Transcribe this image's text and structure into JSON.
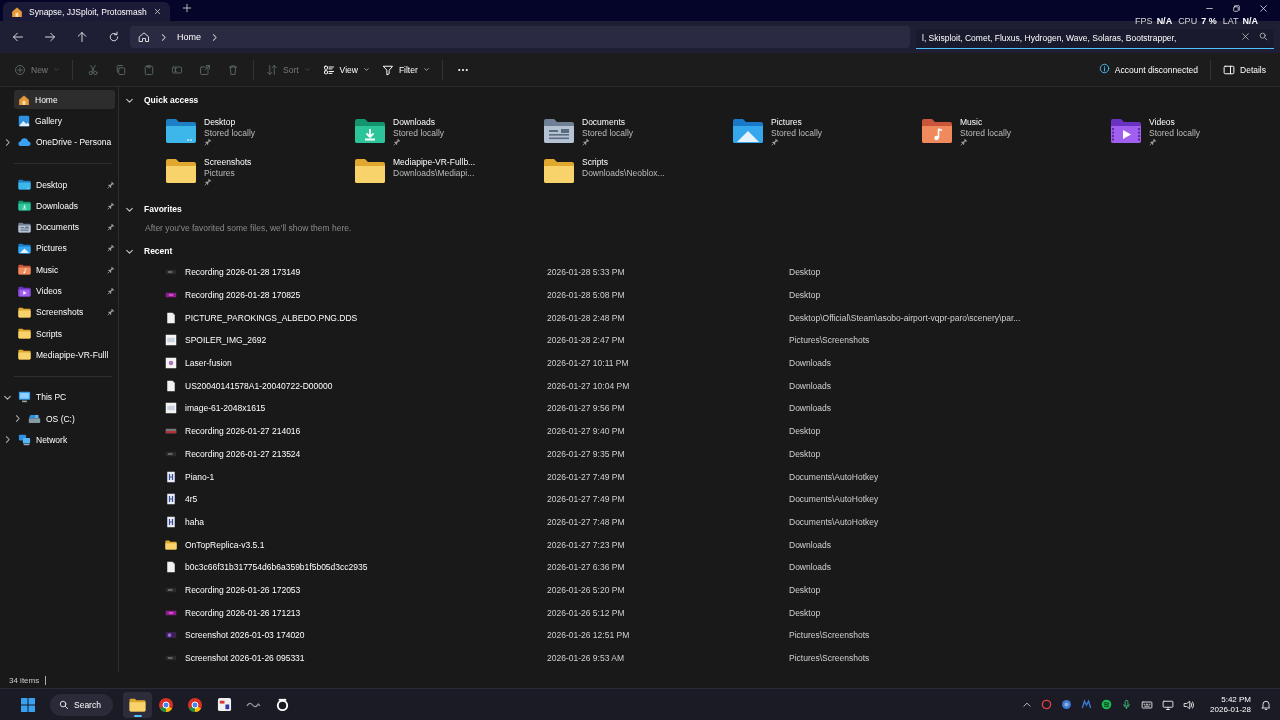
{
  "window": {
    "tabs": [
      {
        "label": "Synapse, JJSploit, Protosmash",
        "selected": true
      }
    ]
  },
  "perf_overlay": [
    {
      "label": "FPS",
      "value": "N/A"
    },
    {
      "label": "CPU",
      "value": "7 %"
    },
    {
      "label": "LAT",
      "value": "N/A"
    }
  ],
  "address_bar": {
    "breadcrumbs": [
      "Home"
    ]
  },
  "search": {
    "value": "l, Skisploit, Comet, Fluxus, Hydrogen, Wave, Solaras, Bootstrapper,"
  },
  "toolbar": {
    "items": [
      {
        "kind": "menu",
        "label": "New",
        "disabled": true
      },
      {
        "kind": "icon",
        "disabled": true
      },
      {
        "kind": "icon",
        "disabled": true
      },
      {
        "kind": "icon",
        "disabled": true
      },
      {
        "kind": "icon",
        "disabled": true
      },
      {
        "kind": "icon",
        "disabled": true
      },
      {
        "kind": "icon",
        "disabled": true
      },
      {
        "kind": "menu",
        "label": "Sort",
        "disabled": true
      },
      {
        "kind": "menu",
        "label": "View",
        "disabled": false
      },
      {
        "kind": "menu",
        "label": "Filter",
        "disabled": false
      },
      {
        "kind": "more",
        "disabled": false
      }
    ],
    "account_status": "Account disconnected",
    "details": "Details"
  },
  "sidebar": {
    "sections": [
      {
        "items": [
          {
            "label": "Home",
            "selected": true
          },
          {
            "label": "Gallery",
            "selected": false
          },
          {
            "label": "OneDrive - Persona",
            "selected": false,
            "expanded": false
          }
        ]
      },
      {
        "items": [
          {
            "label": "Desktop",
            "selected": false,
            "pinned": true
          },
          {
            "label": "Downloads",
            "selected": false,
            "pinned": true
          },
          {
            "label": "Documents",
            "selected": false,
            "pinned": true
          },
          {
            "label": "Pictures",
            "selected": false,
            "pinned": true
          },
          {
            "label": "Music",
            "selected": false,
            "pinned": true
          },
          {
            "label": "Videos",
            "selected": false,
            "pinned": true
          },
          {
            "label": "Screenshots",
            "selected": false,
            "pinned": true
          },
          {
            "label": "Scripts",
            "selected": false,
            "pinned": false
          },
          {
            "label": "Mediapipe-VR-Fulll",
            "selected": false,
            "pinned": false
          }
        ]
      },
      {
        "items": [
          {
            "label": "This PC",
            "selected": false,
            "expanded": true,
            "children": [
              {
                "label": "OS (C:)",
                "selected": false,
                "expanded": false
              }
            ]
          },
          {
            "label": "Network",
            "selected": false,
            "expanded": false
          }
        ]
      }
    ]
  },
  "quick_access": {
    "title": "Quick access",
    "expanded": true,
    "items": [
      {
        "name": "Desktop",
        "detail": "Stored locally",
        "pinned": true
      },
      {
        "name": "Downloads",
        "detail": "Stored locally",
        "pinned": true
      },
      {
        "name": "Documents",
        "detail": "Stored locally",
        "pinned": true
      },
      {
        "name": "Pictures",
        "detail": "Stored locally",
        "pinned": true
      },
      {
        "name": "Music",
        "detail": "Stored locally",
        "pinned": true
      },
      {
        "name": "Videos",
        "detail": "Stored locally",
        "pinned": true
      },
      {
        "name": "Screenshots",
        "detail": "Pictures",
        "pinned": true
      },
      {
        "name": "Mediapipe-VR-Fullb...",
        "detail": "Downloads\\Mediapi...",
        "pinned": false
      },
      {
        "name": "Scripts",
        "detail": "Downloads\\Neoblox...",
        "pinned": false
      }
    ]
  },
  "favorites": {
    "title": "Favorites",
    "expanded": true,
    "message": "After you've favorited some files, we'll show them here."
  },
  "recent": {
    "title": "Recent",
    "expanded": true,
    "files": [
      {
        "name": "Recording 2026-01-28 173149",
        "modified": "2026-01-28 5:33 PM",
        "location": "Desktop"
      },
      {
        "name": "Recording 2026-01-28 170825",
        "modified": "2026-01-28 5:08 PM",
        "location": "Desktop"
      },
      {
        "name": "PICTURE_PAROKINGS_ALBEDO.PNG.DDS",
        "modified": "2026-01-28 2:48 PM",
        "location": "Desktop\\Official\\Steam\\asobo-airport-vqpr-paro\\scenery\\par..."
      },
      {
        "name": "SPOILER_IMG_2692",
        "modified": "2026-01-28 2:47 PM",
        "location": "Pictures\\Screenshots"
      },
      {
        "name": "Laser-fusion",
        "modified": "2026-01-27 10:11 PM",
        "location": "Downloads"
      },
      {
        "name": "US20040141578A1-20040722-D00000",
        "modified": "2026-01-27 10:04 PM",
        "location": "Downloads"
      },
      {
        "name": "image-61-2048x1615",
        "modified": "2026-01-27 9:56 PM",
        "location": "Downloads"
      },
      {
        "name": "Recording 2026-01-27 214016",
        "modified": "2026-01-27 9:40 PM",
        "location": "Desktop"
      },
      {
        "name": "Recording 2026-01-27 213524",
        "modified": "2026-01-27 9:35 PM",
        "location": "Desktop"
      },
      {
        "name": "Piano-1",
        "modified": "2026-01-27 7:49 PM",
        "location": "Documents\\AutoHotkey"
      },
      {
        "name": "4r5",
        "modified": "2026-01-27 7:49 PM",
        "location": "Documents\\AutoHotkey"
      },
      {
        "name": "haha",
        "modified": "2026-01-27 7:48 PM",
        "location": "Documents\\AutoHotkey"
      },
      {
        "name": "OnTopReplica-v3.5.1",
        "modified": "2026-01-27 7:23 PM",
        "location": "Downloads"
      },
      {
        "name": "b0c3c66f31b317754d6b6a359b1f5b05d3cc2935",
        "modified": "2026-01-27 6:36 PM",
        "location": "Downloads"
      },
      {
        "name": "Recording 2026-01-26 172053",
        "modified": "2026-01-26 5:20 PM",
        "location": "Desktop"
      },
      {
        "name": "Recording 2026-01-26 171213",
        "modified": "2026-01-26 5:12 PM",
        "location": "Desktop"
      },
      {
        "name": "Screenshot 2026-01-03 174020",
        "modified": "2026-01-26 12:51 PM",
        "location": "Pictures\\Screenshots"
      },
      {
        "name": "Screenshot 2026-01-26 095331",
        "modified": "2026-01-26 9:53 AM",
        "location": "Pictures\\Screenshots"
      }
    ]
  },
  "status_bar": {
    "item_count": "34 items"
  },
  "taskbar": {
    "search": "Search",
    "time": "5:42 PM",
    "date": "2026-01-28"
  }
}
